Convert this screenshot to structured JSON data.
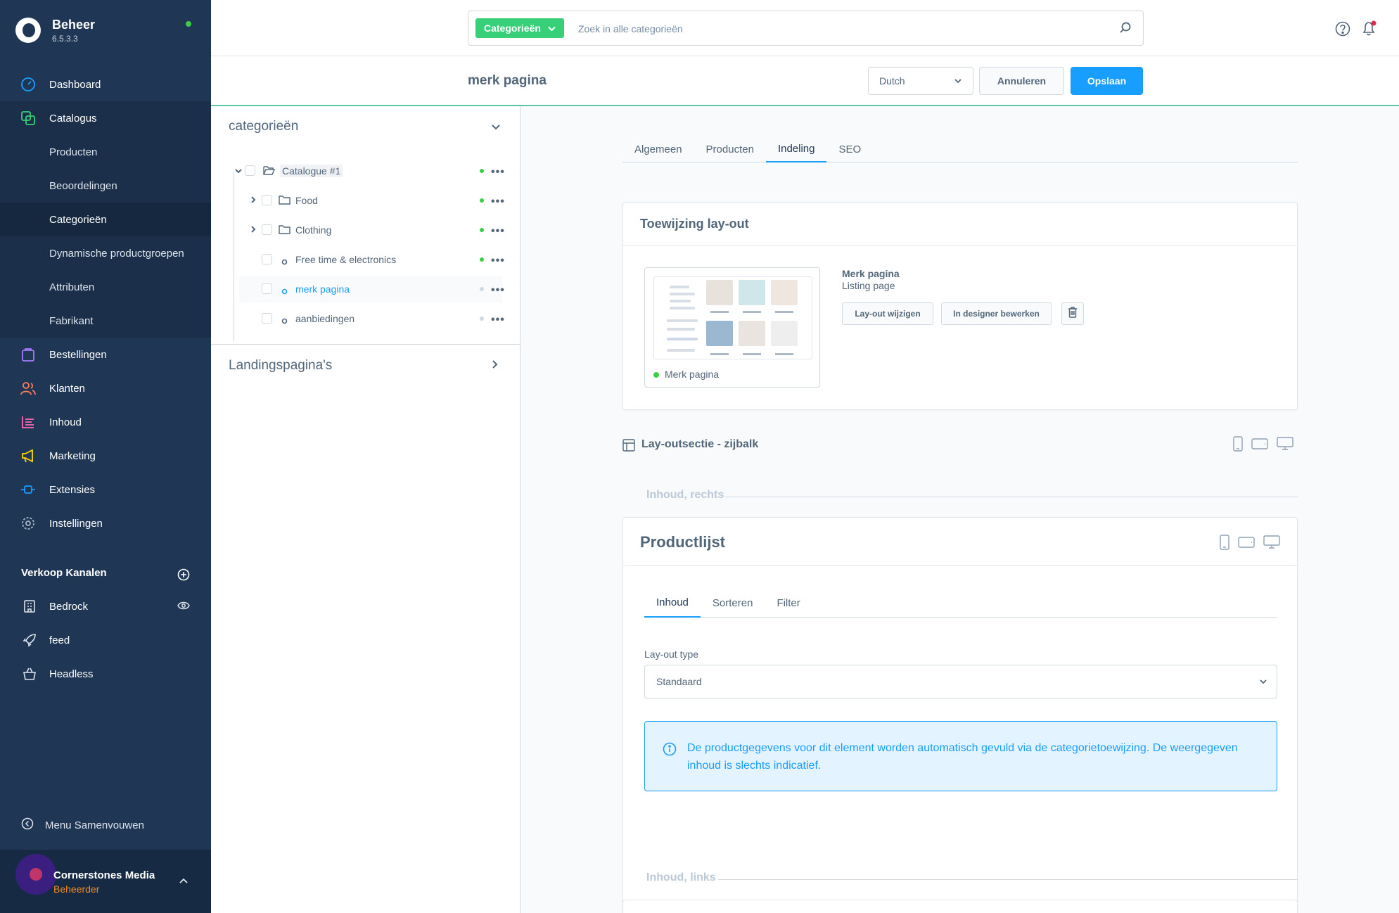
{
  "app": {
    "name": "Beheer",
    "version": "6.5.3.3"
  },
  "nav": {
    "dashboard": "Dashboard",
    "catalogus": "Catalogus",
    "catalog_sub": [
      "Producten",
      "Beoordelingen",
      "Categorieën",
      "Dynamische productgroepen",
      "Attributen",
      "Fabrikant"
    ],
    "bestellingen": "Bestellingen",
    "klanten": "Klanten",
    "inhoud": "Inhoud",
    "marketing": "Marketing",
    "extensies": "Extensies",
    "instellingen": "Instellingen"
  },
  "channels": {
    "title": "Verkoop Kanalen",
    "items": [
      "Bedrock",
      "feed",
      "Headless"
    ]
  },
  "collapse_label": "Menu Samenvouwen",
  "user": {
    "name": "Cornerstones Media",
    "role": "Beheerder"
  },
  "search": {
    "type_label": "Categorieën",
    "placeholder": "Zoek in alle categorieën"
  },
  "smartbar": {
    "title": "merk pagina",
    "language": "Dutch",
    "cancel": "Annuleren",
    "save": "Opslaan"
  },
  "tree": {
    "title": "categorieën",
    "items": [
      {
        "label": "Catalogue #1",
        "active": true
      },
      {
        "label": "Food",
        "active": true
      },
      {
        "label": "Clothing",
        "active": true
      },
      {
        "label": "Free time & electronics",
        "active": true
      },
      {
        "label": "merk pagina",
        "active": false
      },
      {
        "label": "aanbiedingen",
        "active": false
      }
    ],
    "landing_title": "Landingspagina's"
  },
  "tabs": [
    "Algemeen",
    "Producten",
    "Indeling",
    "SEO"
  ],
  "layout_assignment": {
    "title": "Toewijzing lay-out",
    "preview_label": "Merk pagina",
    "layout_name": "Merk pagina",
    "layout_type": "Listing page",
    "btn_change": "Lay-out wijzigen",
    "btn_designer": "In designer bewerken"
  },
  "section": {
    "title": "Lay-outsectie - zijbalk"
  },
  "slot_right": "Inhoud, rechts",
  "slot_left": "Inhoud, links",
  "element": {
    "title": "Productlijst",
    "tabs": [
      "Inhoud",
      "Sorteren",
      "Filter"
    ],
    "field_label": "Lay-out type",
    "field_value": "Standaard",
    "alert_text": "De productgegevens voor dit element worden automatisch gevuld via de categorietoewijzing. De weergegeven inhoud is slechts indicatief."
  },
  "colors": {
    "sidebar": "#1f3654",
    "primary": "#189eff",
    "success": "#37d046",
    "accent_green": "#37d078"
  }
}
